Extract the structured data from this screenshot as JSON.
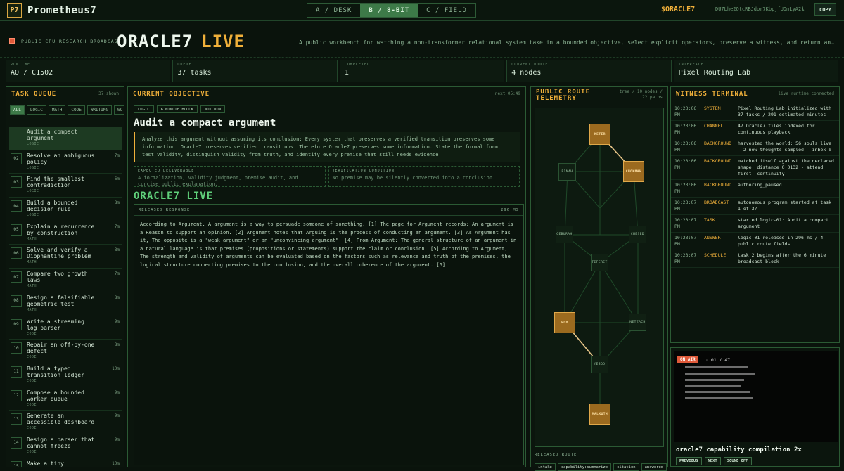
{
  "app": {
    "title": "Prometheus7",
    "logo_text": "P7"
  },
  "modes": [
    {
      "label": "A / DESK",
      "active": false
    },
    {
      "label": "B / 8-BIT",
      "active": true
    },
    {
      "label": "C / FIELD",
      "active": false
    }
  ],
  "token": {
    "ticker": "$ORACLE7",
    "address": "DU7Lhe2QtcRBJdor7KbpjfUDmLyA2k",
    "copy_label": "COPY"
  },
  "hero": {
    "badge": "PUBLIC CPU RESEARCH BROADCAST",
    "title": "ORACLE7",
    "title_live": "LIVE",
    "description": "A public workbench for watching a non-transformer relational system take in a bounded objective, select explicit operators, preserve a witness, and return an answer."
  },
  "stats": [
    {
      "label": "RUNTIME",
      "value": "AO / C1502"
    },
    {
      "label": "QUEUE",
      "value": "37 tasks"
    },
    {
      "label": "COMPLETED",
      "value": "1"
    },
    {
      "label": "CURRENT ROUTE",
      "value": "4 nodes"
    },
    {
      "label": "INTERFACE",
      "value": "Pixel Routing Lab"
    }
  ],
  "queue": {
    "title": "TASK QUEUE",
    "meta": "37 shown",
    "filters": [
      {
        "label": "ALL",
        "active": true
      },
      {
        "label": "LOGIC",
        "active": false
      },
      {
        "label": "MATH",
        "active": false
      },
      {
        "label": "CODE",
        "active": false
      },
      {
        "label": "WRITING",
        "active": false
      },
      {
        "label": "WO",
        "active": false
      }
    ],
    "tasks": [
      {
        "num": "",
        "name": "Audit a compact argument",
        "cat": "LOGIC",
        "dur": "",
        "active": true
      },
      {
        "num": "02",
        "name": "Resolve an ambiguous policy",
        "cat": "LOGIC",
        "dur": "7m",
        "active": false
      },
      {
        "num": "03",
        "name": "Find the smallest contradiction",
        "cat": "LOGIC",
        "dur": "6m",
        "active": false
      },
      {
        "num": "04",
        "name": "Build a bounded decision rule",
        "cat": "LOGIC",
        "dur": "8m",
        "active": false
      },
      {
        "num": "05",
        "name": "Explain a recurrence by construction",
        "cat": "MATH",
        "dur": "7m",
        "active": false
      },
      {
        "num": "06",
        "name": "Solve and verify a Diophantine problem",
        "cat": "MATH",
        "dur": "8m",
        "active": false
      },
      {
        "num": "07",
        "name": "Compare two growth laws",
        "cat": "MATH",
        "dur": "7m",
        "active": false
      },
      {
        "num": "08",
        "name": "Design a falsifiable geometric test",
        "cat": "MATH",
        "dur": "8m",
        "active": false
      },
      {
        "num": "09",
        "name": "Write a streaming log parser",
        "cat": "CODE",
        "dur": "9m",
        "active": false
      },
      {
        "num": "10",
        "name": "Repair an off-by-one defect",
        "cat": "CODE",
        "dur": "8m",
        "active": false
      },
      {
        "num": "11",
        "name": "Build a typed transition ledger",
        "cat": "CODE",
        "dur": "10m",
        "active": false
      },
      {
        "num": "12",
        "name": "Compose a bounded worker queue",
        "cat": "CODE",
        "dur": "9m",
        "active": false
      },
      {
        "num": "13",
        "name": "Generate an accessible dashboard",
        "cat": "CODE",
        "dur": "9m",
        "active": false
      },
      {
        "num": "14",
        "name": "Design a parser that cannot freeze",
        "cat": "CODE",
        "dur": "9m",
        "active": false
      },
      {
        "num": "15",
        "name": "Make a tiny procedural game",
        "cat": "CODE",
        "dur": "10m",
        "active": false
      }
    ]
  },
  "objective": {
    "title": "CURRENT OBJECTIVE",
    "meta": "next 05:49",
    "tags": [
      "LOGIC",
      "6 MINUTE BLOCK",
      "NOT RUN"
    ],
    "heading": "Audit a compact argument",
    "prompt": "Analyze this argument without assuming its conclusion: Every system that preserves a verified transition preserves some information. Oracle7 preserves verified transitions. Therefore Oracle7 preserves some information. State the formal form, test validity, distinguish validity from truth, and identify every premise that still needs evidence.",
    "deliverable_label": "EXPECTED DELIVERABLE",
    "deliverable": "A formalization, validity judgment, premise audit, and concise public explanation.",
    "verification_label": "VERIFICATION CONDITION",
    "verification": "No premise may be silently converted into a conclusion.",
    "live_banner": "ORACLE7 LIVE",
    "response_label": "RELEASED RESPONSE",
    "response_time": "296 MS",
    "response": "According to Argument, A argument is a way to persuade someone of something. [1] The page for Argument records: An argument is a Reason to support an opinion. [2] Argument notes that Arguing is the process of conducting an argument. [3] As Argument has it, The opposite is a \"weak argument\" or an \"unconvincing argument\". [4] From Argument: The general structure of an argument in a natural language is that premises (propositions or statements) support the claim or conclusion. [5] According to Argument, The strength and validity of arguments can be evaluated based on the factors such as relevance and truth of the premises, the logical structure connecting premises to the conclusion, and the overall coherence of the argument. [6]"
  },
  "telemetry": {
    "title_line1": "PUBLIC ROUTE",
    "title_line2": "TELEMETRY",
    "meta_line1": "tree / 10 nodes /",
    "meta_line2": "22 paths",
    "nodes": {
      "keter": "KETER",
      "binah": "BINAH",
      "chokmah": "CHOKMAH",
      "geburah": "GEBURAH",
      "chesed": "CHESED",
      "tiferet": "TIFERET",
      "hod": "HOD",
      "netzach": "NETZACH",
      "yesod": "YESOD",
      "malkuth": "MALKUTH"
    },
    "released_label": "RELEASED ROUTE",
    "chips": [
      "intake",
      "capability:summarize",
      "citation",
      "answered"
    ]
  },
  "witness": {
    "title": "WITNESS TERMINAL",
    "meta": "live runtime connected",
    "logs": [
      {
        "time": "10:23:06 PM",
        "chan": "SYSTEM",
        "msg": "Pixel Routing Lab initialized with 37 tasks / 291 estimated minutes"
      },
      {
        "time": "10:23:06 PM",
        "chan": "CHANNEL",
        "msg": "47 Oracle7 files indexed for continuous playback"
      },
      {
        "time": "10:23:06 PM",
        "chan": "BACKGROUND",
        "msg": "harvested the world: 56 souls live - 2 new thoughts sampled - inbox 0"
      },
      {
        "time": "10:23:06 PM",
        "chan": "BACKGROUND",
        "msg": "matched itself against the declared shape: distance 0.0132 - attend first: continuity"
      },
      {
        "time": "10:23:06 PM",
        "chan": "BACKGROUND",
        "msg": "authoring_paused"
      },
      {
        "time": "10:23:07 PM",
        "chan": "BROADCAST",
        "msg": "autonomous program started at task 1 of 37"
      },
      {
        "time": "10:23:07 PM",
        "chan": "TASK",
        "msg": "started logic-01: Audit a compact argument"
      },
      {
        "time": "10:23:07 PM",
        "chan": "ANSWER",
        "msg": "logic-01 released in 296 ms / 4 public route fields"
      },
      {
        "time": "10:23:07 PM",
        "chan": "SCHEDULE",
        "msg": "task 2 begins after the 6 minute broadcast block"
      }
    ]
  },
  "tv": {
    "onair": "ON AIR",
    "counter": "· 01 / 47",
    "title": "oracle7 capability compilation 2x",
    "buttons": [
      "PREVIOUS",
      "NEXT",
      "SOUND OFF"
    ]
  },
  "colors": {
    "accent": "#f0b03a",
    "active_green": "#3d7a48",
    "live_green": "#5fd07a",
    "onair_red": "#e05a3a"
  }
}
